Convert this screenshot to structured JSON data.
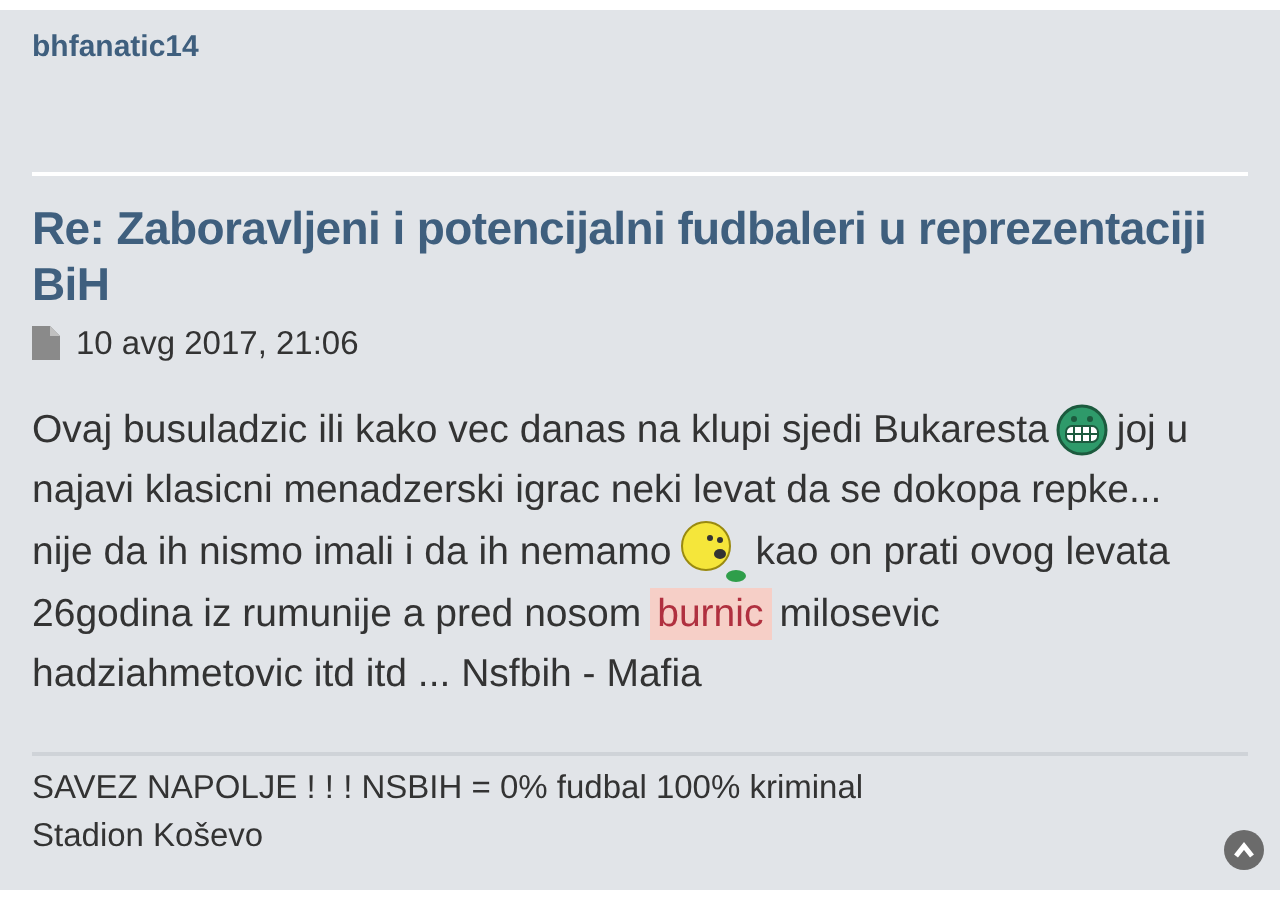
{
  "post": {
    "author": "bhfanatic14",
    "title": "Re: Zaboravljeni i potencijalni fudbaleri u reprezentaciji BiH",
    "date": "10 avg 2017, 21:06",
    "body": [
      [
        {
          "kind": "text",
          "text": "Ovaj busuladzic ili kako vec danas na klupi sjedi Bukaresta"
        },
        {
          "kind": "grin-smiley"
        },
        {
          "kind": "text",
          "text": "joj u"
        }
      ],
      [
        {
          "kind": "text",
          "text": "najavi klasicni menadzerski igrac neki levat da se dokopa repke..."
        }
      ],
      [
        {
          "kind": "text",
          "text": "nije da ih nismo imali i da ih nemamo"
        },
        {
          "kind": "sick-smiley"
        },
        {
          "kind": "text",
          "text": "kao on prati ovog levata"
        }
      ],
      [
        {
          "kind": "text",
          "text": "26godina iz rumunije a pred nosom"
        },
        {
          "kind": "highlight",
          "text": "burnic"
        },
        {
          "kind": "text",
          "text": "milosevic"
        }
      ],
      [
        {
          "kind": "text",
          "text": "hadziahmetovic itd itd ... Nsfbih - Mafia"
        }
      ]
    ],
    "signature": [
      "SAVEZ NAPOLJE ! ! ! NSBIH = 0% fudbal 100% kriminal",
      "Stadion Koševo"
    ]
  }
}
